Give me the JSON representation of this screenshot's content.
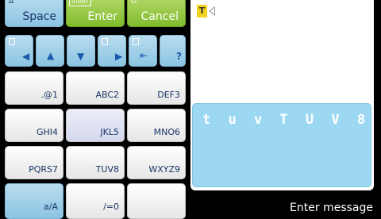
{
  "top_keys": [
    {
      "id": "space",
      "badge": "Δ",
      "label": "Space"
    },
    {
      "id": "enter",
      "badge": "START",
      "label": "Enter"
    },
    {
      "id": "cancel",
      "badge": "O",
      "label": "Cancel"
    }
  ],
  "nav_keys": [
    {
      "id": "left",
      "badge": "L",
      "glyph": "◀"
    },
    {
      "id": "up",
      "glyph": "▲"
    },
    {
      "id": "down",
      "glyph": "▼"
    },
    {
      "id": "right",
      "badge": "R",
      "glyph": "▶"
    },
    {
      "id": "backspace",
      "glyph": "⇤"
    },
    {
      "id": "help",
      "glyph": "?"
    }
  ],
  "keypad": [
    [
      ".@1",
      "ABC2",
      "DEF3"
    ],
    [
      "GHI4",
      "JKL5",
      "MNO6"
    ],
    [
      "PQRS7",
      "TUV8",
      "WXYZ9"
    ],
    [
      "a/A",
      "/=0",
      ""
    ]
  ],
  "mode_badge": "T",
  "entry_text": "t u v T U V 8",
  "status_text": "Enter message",
  "colors": {
    "green": "#82bb2d",
    "blue": "#9cd8f2",
    "accent": "#1a3566"
  }
}
